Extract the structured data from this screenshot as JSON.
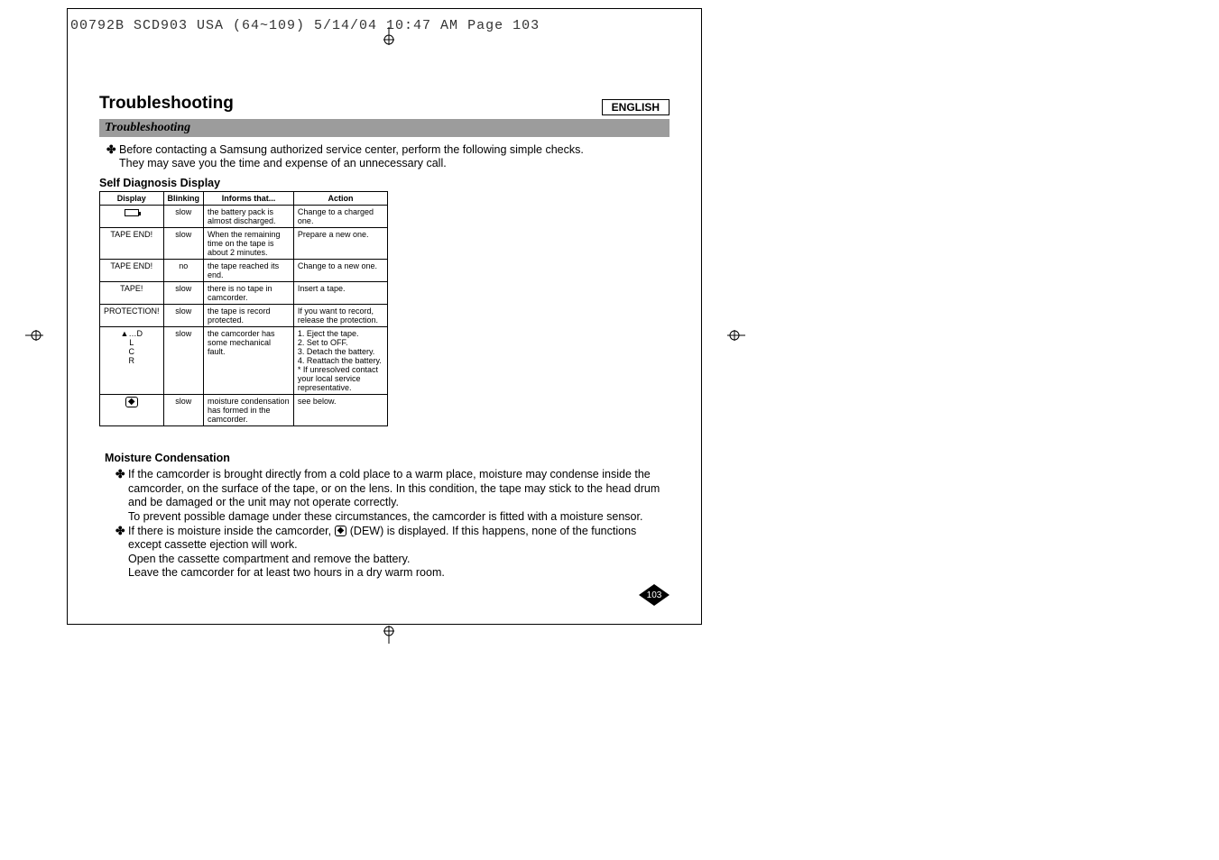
{
  "header": {
    "text": "00792B SCD903 USA (64~109)  5/14/04 10:47 AM  Page 103"
  },
  "lang": "ENGLISH",
  "title": "Troubleshooting",
  "section_bar": "Troubleshooting",
  "intro": {
    "bullet": "✤",
    "line1": "Before contacting a Samsung authorized service center, perform the following simple checks.",
    "line2": "They may save you the time and expense of an unnecessary call."
  },
  "diag_head": "Self Diagnosis Display",
  "diag_table": {
    "headers": [
      "Display",
      "Blinking",
      "Informs that...",
      "Action"
    ],
    "rows": [
      {
        "display_icon": "battery",
        "display": "",
        "blinking": "slow",
        "informs": "the battery pack is almost discharged.",
        "action": "Change to a charged one."
      },
      {
        "display": "TAPE END!",
        "blinking": "slow",
        "informs": "When the remaining time on the tape is about 2 minutes.",
        "action": "Prepare a new one."
      },
      {
        "display": "TAPE END!",
        "blinking": "no",
        "informs": "the tape reached its end.",
        "action": "Change to a new one."
      },
      {
        "display": "TAPE!",
        "blinking": "slow",
        "informs": "there is no tape in camcorder.",
        "action": "Insert a tape."
      },
      {
        "display": "PROTECTION!",
        "blinking": "slow",
        "informs": "the tape is record protected.",
        "action": "If you want to record, release the protection."
      },
      {
        "display": "▲…D\nL\nC\nR",
        "blinking": "slow",
        "informs": "the camcorder has some mechanical fault.",
        "action": "1. Eject the tape.\n2. Set to OFF.\n3. Detach the battery.\n4. Reattach the battery.\n* If unresolved contact your local service representative."
      },
      {
        "display_icon": "dew",
        "display": "",
        "blinking": "slow",
        "informs": "moisture condensation has formed in the camcorder.",
        "action": "see below."
      }
    ]
  },
  "moist_head": "Moisture Condensation",
  "moist": {
    "b1": "✤",
    "p1a": "If the camcorder is brought directly from a cold place to a warm place, moisture may condense inside the camcorder, on the surface of the tape, or on the lens. In this condition, the tape may stick to the head drum and be damaged or the unit may not operate correctly.",
    "p1b": "To prevent possible damage under these circumstances, the camcorder is fitted with a moisture sensor.",
    "b2": "✤",
    "p2a_before": "If there is moisture inside the camcorder, ",
    "p2a_after": " (DEW) is displayed. If this happens, none of the functions except cassette ejection will work.",
    "p2b": "Open the cassette compartment and remove the battery.",
    "p2c": "Leave the camcorder for at least two hours in a dry warm room."
  },
  "page_number": "103"
}
